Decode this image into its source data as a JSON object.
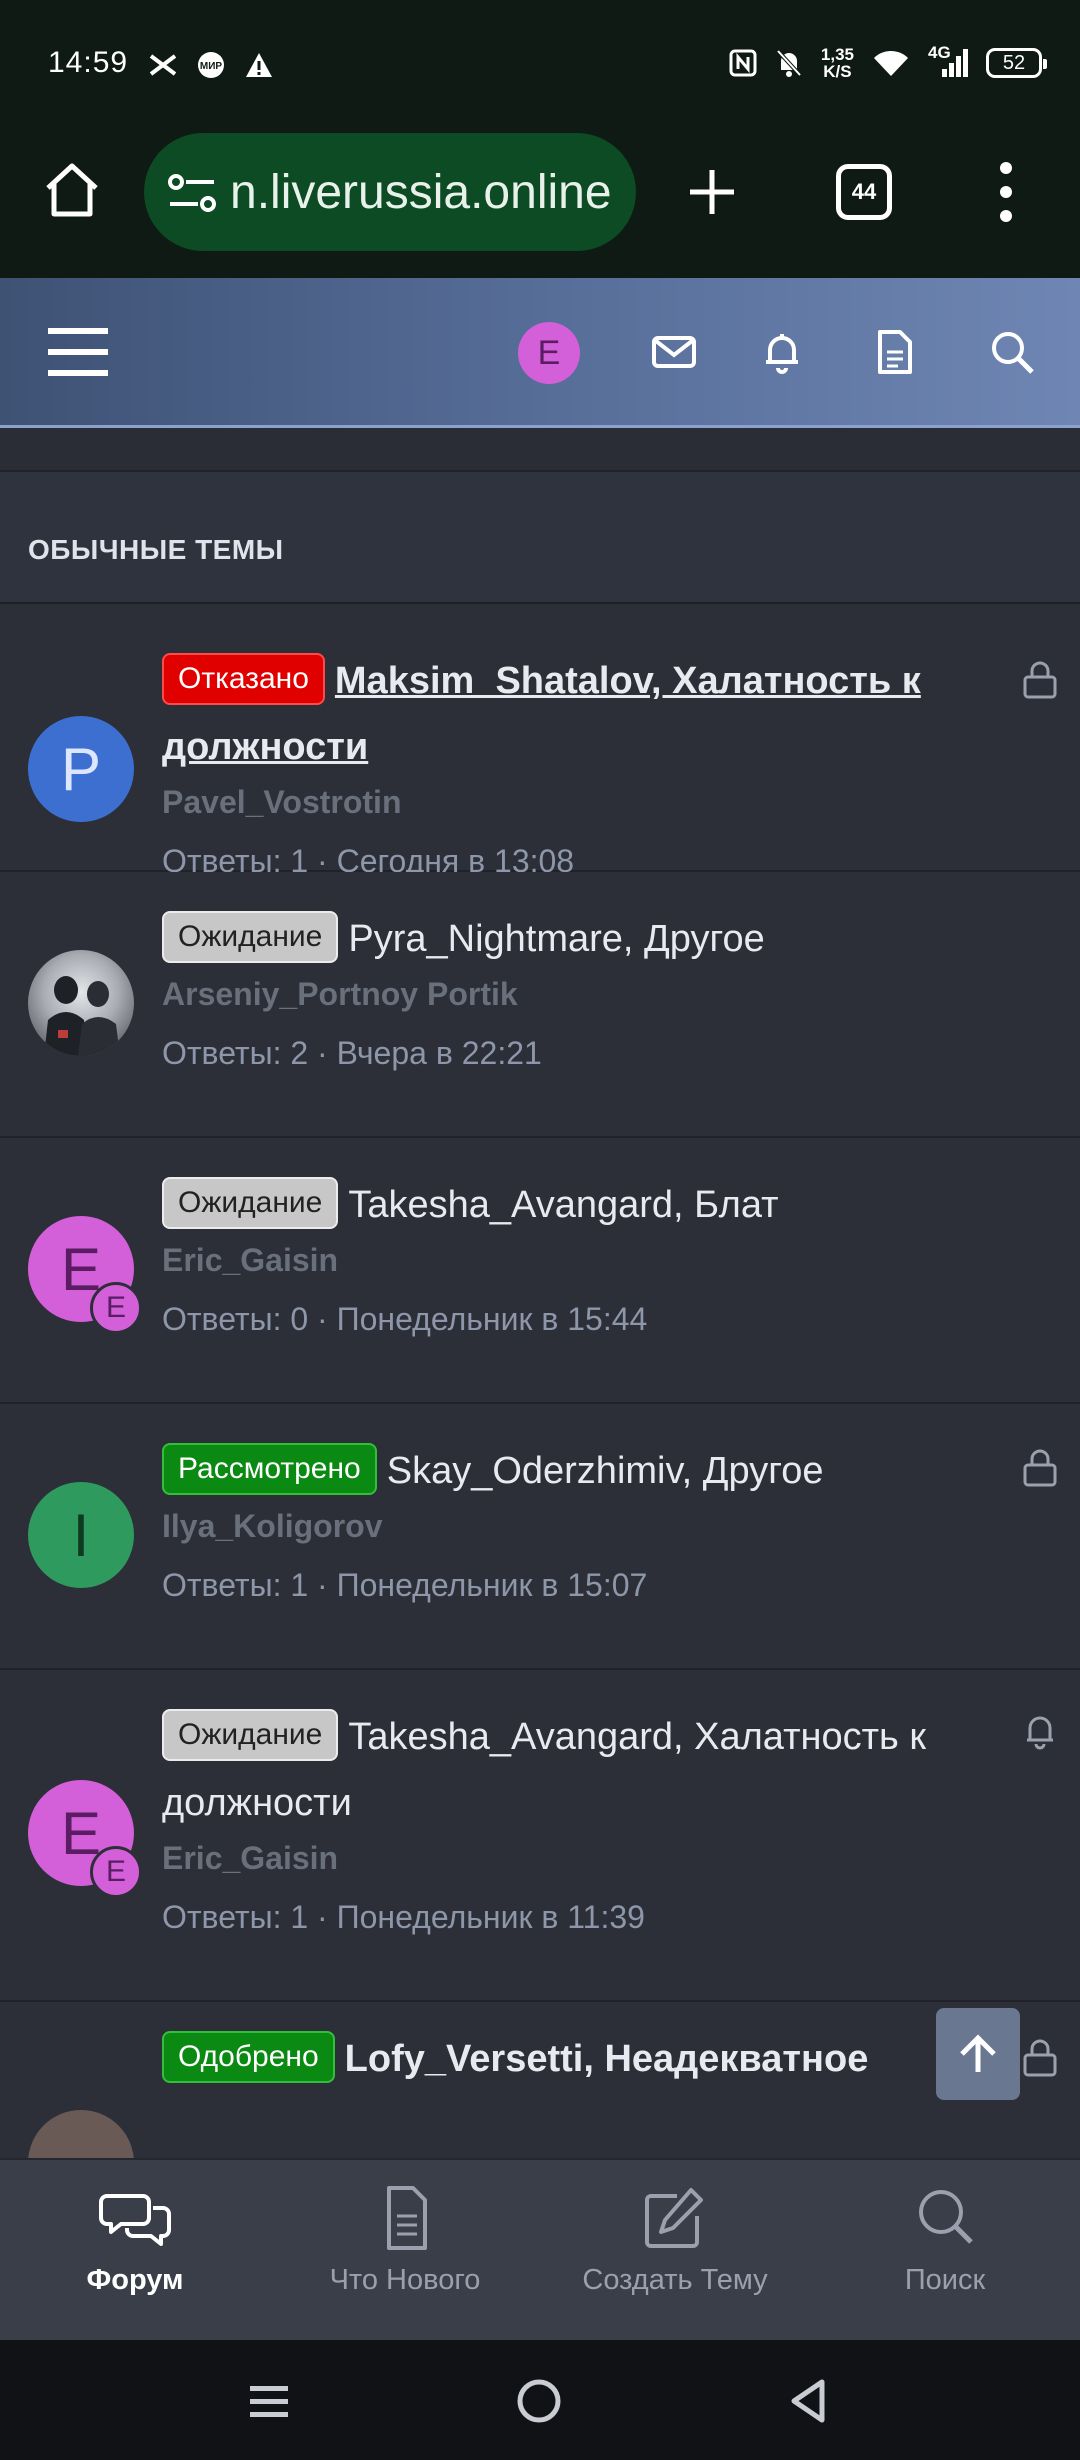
{
  "status_bar": {
    "time": "14:59",
    "net_speed_value": "1,35",
    "net_speed_unit": "K/S",
    "network": "4G",
    "battery": "52"
  },
  "browser": {
    "url": "n.liverussia.online",
    "tab_count": "44"
  },
  "header": {
    "user_initial": "E",
    "avatar_color": "#d35fd9"
  },
  "section": {
    "title": "ОБЫЧНЫЕ ТЕМЫ"
  },
  "threads": [
    {
      "badge": "Отказано",
      "badge_color": "#e00000",
      "title_line1": "Maksim_Shatalov, Халатность к",
      "title_line2": "должности",
      "author": "Pavel_Vostrotin",
      "meta": "Ответы: 1 · Сегодня в 13:08",
      "avatar_letter": "P",
      "avatar_color": "#3d6fd1",
      "status_icon": "lock-icon"
    },
    {
      "badge": "Ожидание",
      "badge_color": "#c7c7c7",
      "title_line1": "Pyra_Nightmare, Другое",
      "author": "Arseniy_Portnoy Portik",
      "meta": "Ответы: 2 · Вчера в 22:21",
      "avatar_letter": "",
      "avatar_color": "#555a63"
    },
    {
      "badge": "Ожидание",
      "badge_color": "#c7c7c7",
      "title_line1": "Takesha_Avangard, Блат",
      "author": "Eric_Gaisin",
      "meta": "Ответы: 0 · Понедельник в 15:44",
      "avatar_letter": "E",
      "avatar_sub_letter": "E",
      "avatar_color": "#d35fd9"
    },
    {
      "badge": "Рассмотрено",
      "badge_color": "#0a8a12",
      "title_line1": "Skay_Oderzhimiv, Другое",
      "author": "Ilya_Koligorov",
      "meta": "Ответы: 1 · Понедельник в 15:07",
      "avatar_letter": "I",
      "avatar_color": "#2e9a5e",
      "status_icon": "lock-icon"
    },
    {
      "badge": "Ожидание",
      "badge_color": "#c7c7c7",
      "title_line1": "Takesha_Avangard, Халатность к",
      "title_line2": "должности",
      "author": "Eric_Gaisin",
      "meta": "Ответы: 1 · Понедельник в 11:39",
      "avatar_letter": "E",
      "avatar_sub_letter": "E",
      "avatar_color": "#d35fd9",
      "status_icon": "bell-icon"
    },
    {
      "badge": "Одобрено",
      "badge_color": "#0a8a12",
      "title_line1": "Lofy_Versetti, Неадекватное",
      "status_icon": "lock-icon"
    }
  ],
  "bottom_nav": [
    {
      "label": "Форум",
      "icon": "chat-bubbles-icon",
      "active": true
    },
    {
      "label": "Что Нового",
      "icon": "document-icon",
      "active": false
    },
    {
      "label": "Создать Тему",
      "icon": "edit-icon",
      "active": false
    },
    {
      "label": "Поиск",
      "icon": "search-icon",
      "active": false
    }
  ]
}
